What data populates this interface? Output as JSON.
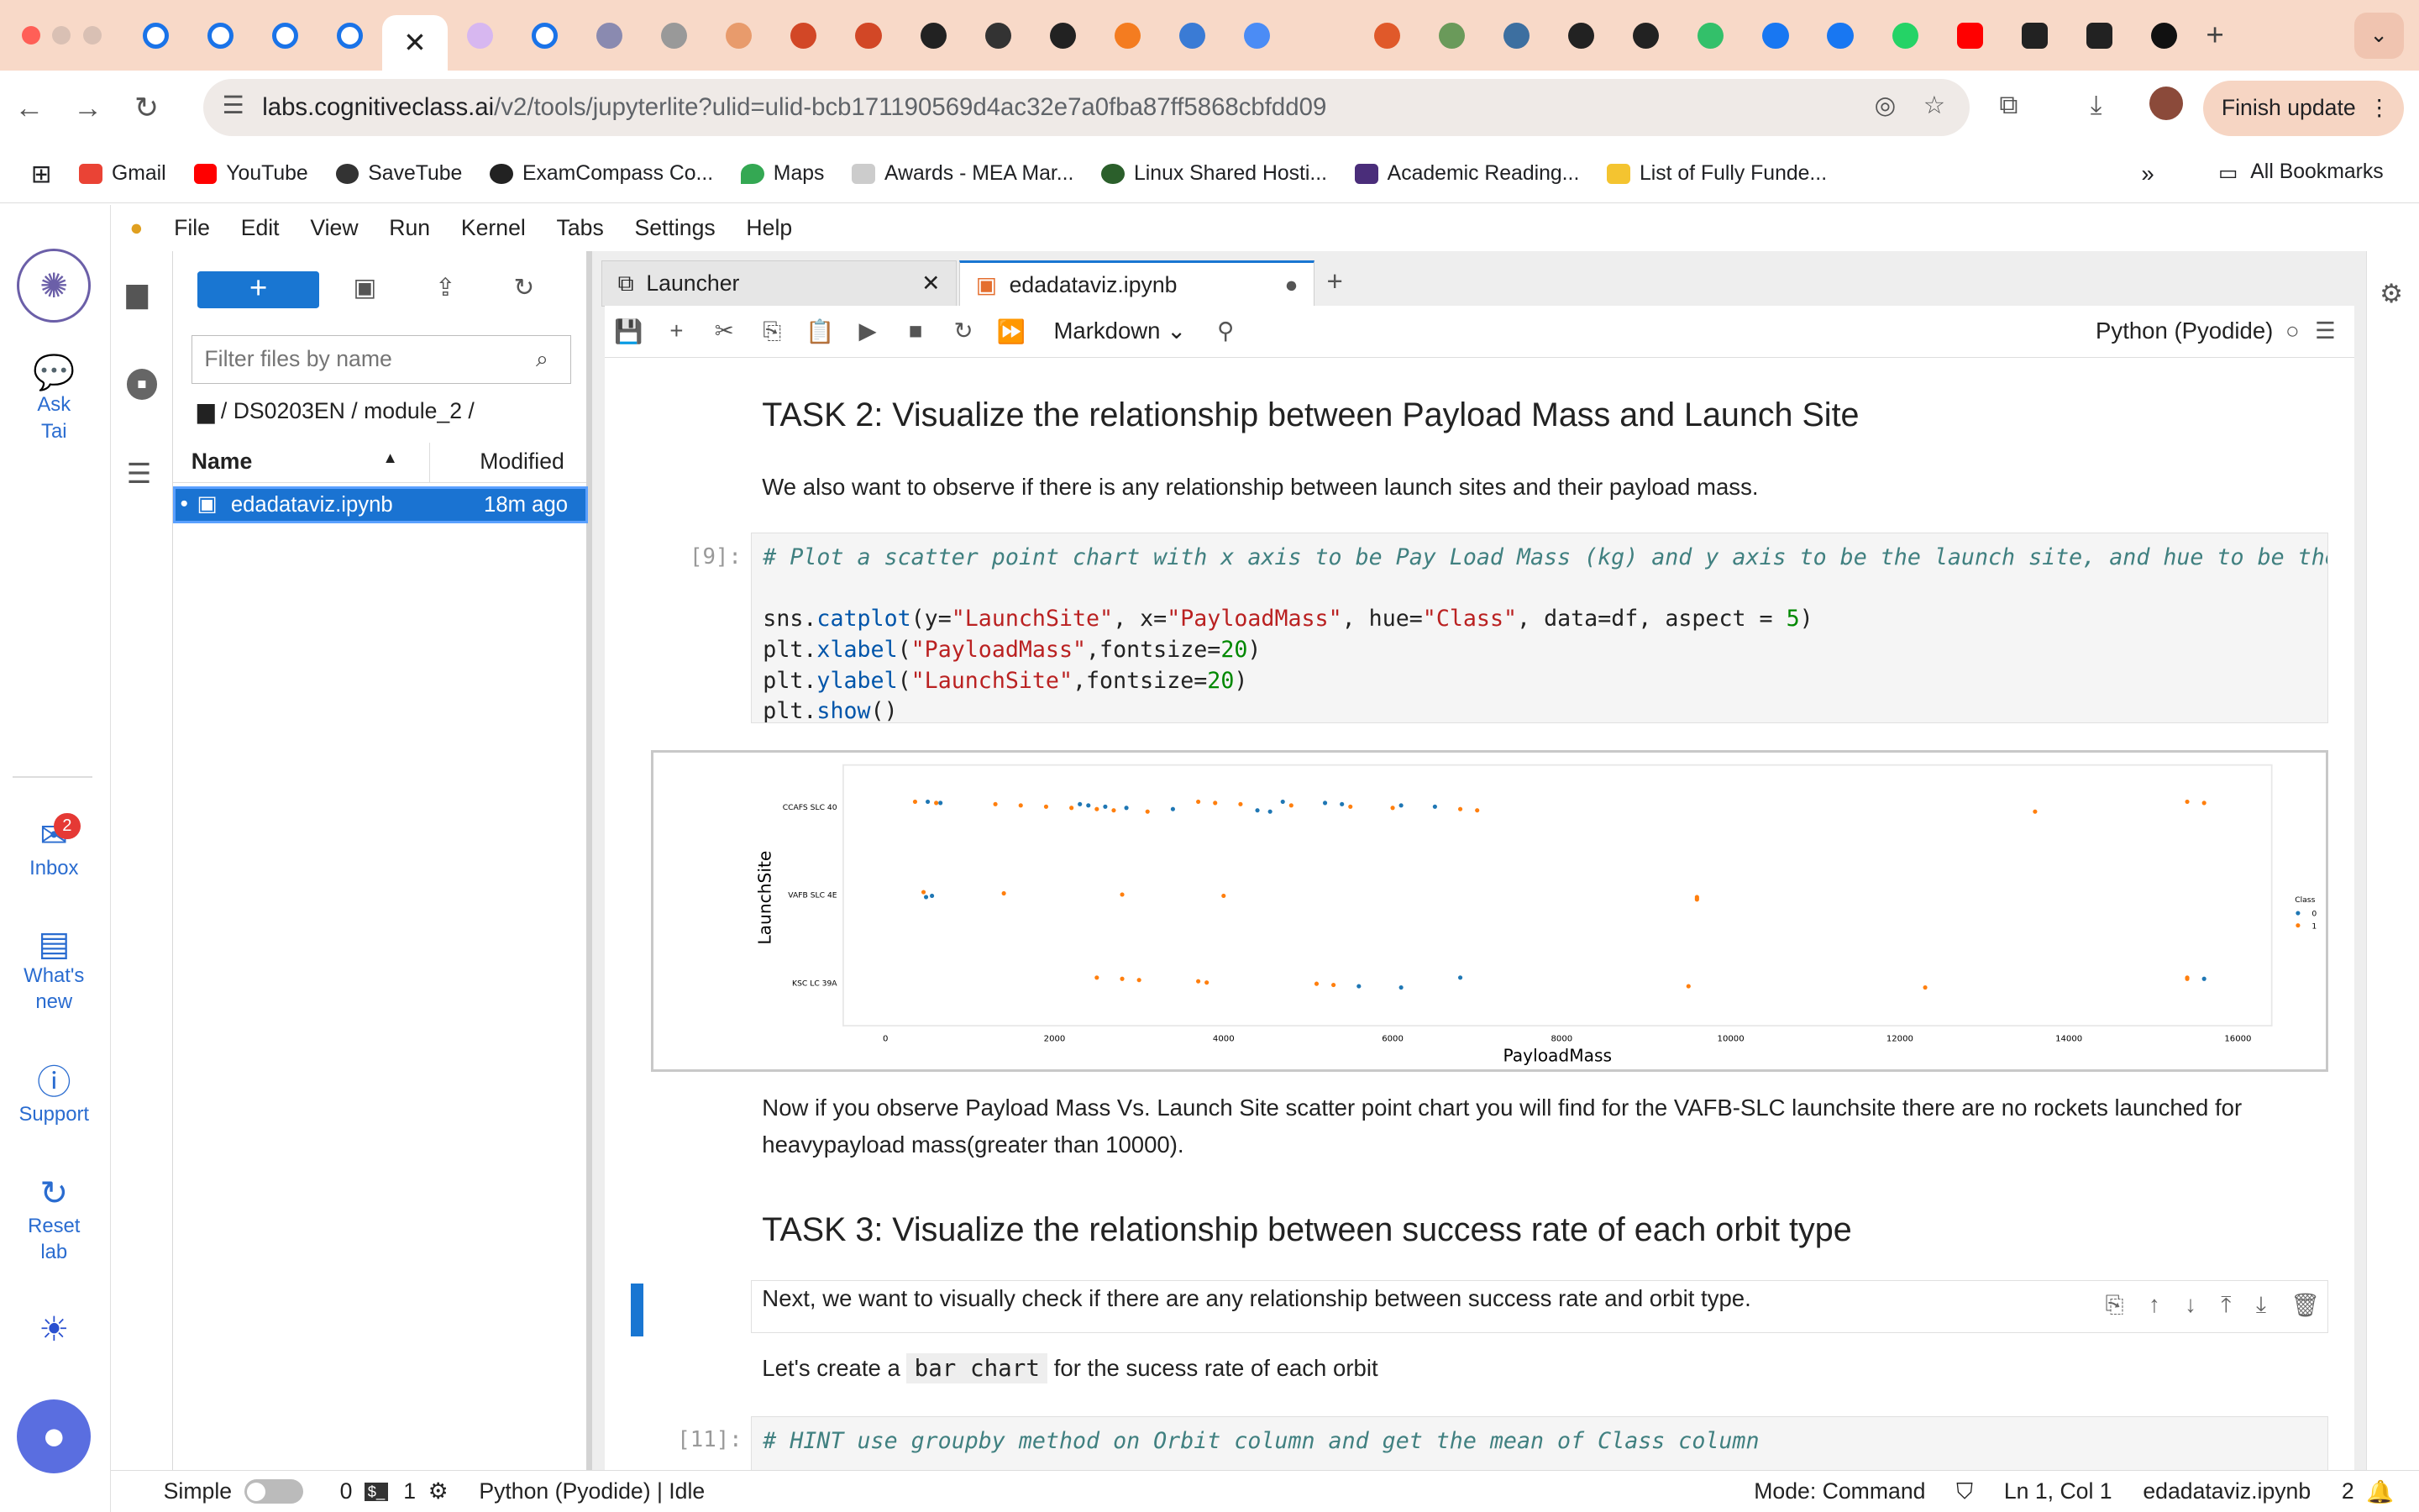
{
  "browser": {
    "active_tab_icon": "close-icon",
    "url_host": "labs.cognitiveclass.ai",
    "url_path": "/v2/tools/jupyterlite?ulid=ulid-bcb171190569d4ac32e7a0fba87ff5868cbfdd09",
    "finish_update": "Finish update",
    "bookmarks": [
      "Gmail",
      "YouTube",
      "SaveTube",
      "ExamCompass Co...",
      "Maps",
      "Awards - MEA Mar...",
      "Linux Shared Hosti...",
      "Academic Reading...",
      "List of Fully Funde..."
    ],
    "all_bookmarks": "All Bookmarks"
  },
  "rail": {
    "ask": "Ask Tai",
    "inbox": "Inbox",
    "inbox_badge": "2",
    "whats_new": "What's new",
    "support": "Support",
    "reset": "Reset lab"
  },
  "menu": [
    "File",
    "Edit",
    "View",
    "Run",
    "Kernel",
    "Tabs",
    "Settings",
    "Help"
  ],
  "files": {
    "filter_placeholder": "Filter files by name",
    "breadcrumb": "/ DS0203EN / module_2 /",
    "col_name": "Name",
    "col_modified": "Modified",
    "file_name": "edadataviz.ipynb",
    "file_modified": "18m ago"
  },
  "tabs": {
    "launcher": "Launcher",
    "notebook": "edadataviz.ipynb"
  },
  "toolbar": {
    "cell_type": "Markdown",
    "kernel": "Python (Pyodide)"
  },
  "notebook": {
    "task2_title": "TASK 2: Visualize the relationship between Payload Mass and Launch Site",
    "task2_text": "We also want to observe if there is any relationship between launch sites and their payload mass.",
    "cell9_prompt": "[9]:",
    "cell9_comment": "# Plot a scatter point chart with x axis to be Pay Load Mass (kg) and y axis to be the launch site, and hue to be the c",
    "observe_text": "Now if you observe Payload Mass Vs. Launch Site scatter point chart you will find for the VAFB-SLC launchsite there are no rockets launched for heavypayload mass(greater than 10000).",
    "task3_title": "TASK 3: Visualize the relationship between success rate of each orbit type",
    "next_text": "Next, we want to visually check if there are any relationship between success rate and orbit type.",
    "lets_create_pre": "Let's create a",
    "lets_create_code": "bar chart",
    "lets_create_post": "for the sucess rate of each orbit",
    "cell11_prompt": "[11]:",
    "cell11_comment": "# HINT use groupby method on Orbit column and get the mean of Class column"
  },
  "status": {
    "mode": "Simple",
    "count_a": "0",
    "count_b": "1",
    "kernel_status": "Python (Pyodide) | Idle",
    "command_mode": "Mode: Command",
    "cursor": "Ln 1, Col 1",
    "file": "edadataviz.ipynb",
    "notif": "2"
  },
  "chart_data": {
    "type": "scatter",
    "xlabel": "PayloadMass",
    "ylabel": "LaunchSite",
    "xlim": [
      -500,
      16400
    ],
    "xticks": [
      0,
      2000,
      4000,
      6000,
      8000,
      10000,
      12000,
      14000,
      16000
    ],
    "categories": [
      "CCAFS SLC 40",
      "VAFB SLC 4E",
      "KSC LC 39A"
    ],
    "legend_title": "Class",
    "legend_position": "right",
    "series": [
      {
        "name": "0",
        "color": "#1f77b4",
        "points": [
          [
            500,
            0
          ],
          [
            650,
            0
          ],
          [
            2300,
            0
          ],
          [
            2400,
            0
          ],
          [
            2600,
            0
          ],
          [
            2850,
            0
          ],
          [
            3400,
            0
          ],
          [
            4400,
            0
          ],
          [
            4550,
            0
          ],
          [
            4700,
            0
          ],
          [
            5200,
            0
          ],
          [
            5400,
            0
          ],
          [
            6100,
            0
          ],
          [
            6500,
            0
          ],
          [
            550,
            1
          ],
          [
            480,
            1
          ],
          [
            5600,
            2
          ],
          [
            6100,
            2
          ],
          [
            6800,
            2
          ],
          [
            15600,
            2
          ]
        ]
      },
      {
        "name": "1",
        "color": "#ff7f0e",
        "points": [
          [
            350,
            0
          ],
          [
            600,
            0
          ],
          [
            1300,
            0
          ],
          [
            1600,
            0
          ],
          [
            1900,
            0
          ],
          [
            2200,
            0
          ],
          [
            2500,
            0
          ],
          [
            2700,
            0
          ],
          [
            3100,
            0
          ],
          [
            3700,
            0
          ],
          [
            3900,
            0
          ],
          [
            4200,
            0
          ],
          [
            4800,
            0
          ],
          [
            5500,
            0
          ],
          [
            6000,
            0
          ],
          [
            6800,
            0
          ],
          [
            7000,
            0
          ],
          [
            13600,
            0
          ],
          [
            15400,
            0
          ],
          [
            15600,
            0
          ],
          [
            450,
            1
          ],
          [
            1400,
            1
          ],
          [
            2800,
            1
          ],
          [
            4000,
            1
          ],
          [
            9600,
            1
          ],
          [
            9600,
            1
          ],
          [
            9600,
            1
          ],
          [
            2500,
            2
          ],
          [
            2800,
            2
          ],
          [
            3000,
            2
          ],
          [
            3700,
            2
          ],
          [
            3800,
            2
          ],
          [
            5100,
            2
          ],
          [
            5300,
            2
          ],
          [
            9500,
            2
          ],
          [
            12300,
            2
          ],
          [
            15400,
            2
          ],
          [
            15400,
            2
          ]
        ]
      }
    ]
  }
}
